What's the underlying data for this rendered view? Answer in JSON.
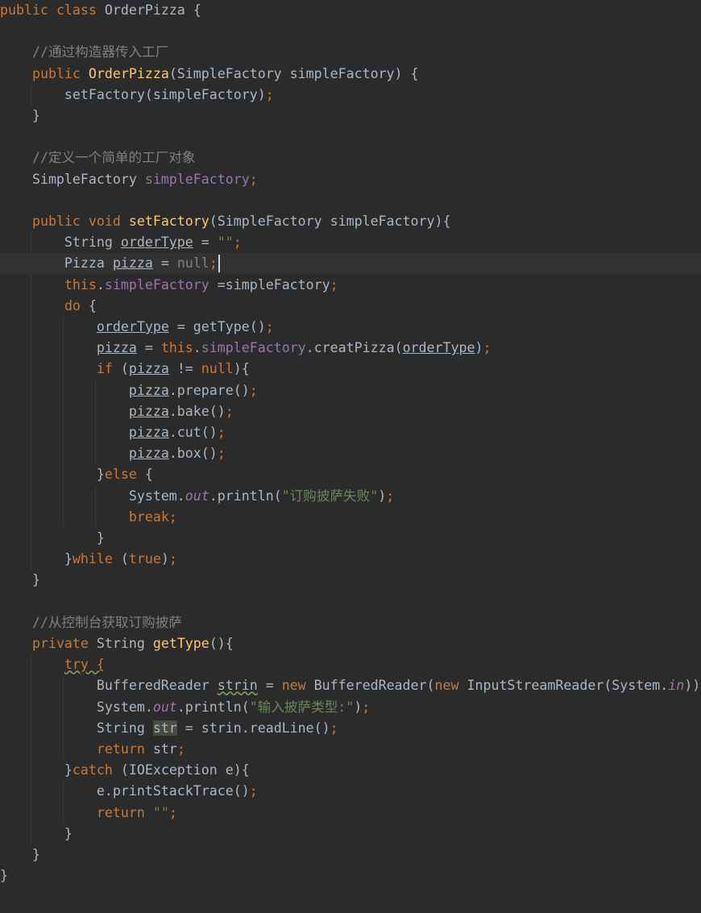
{
  "editor": {
    "theme_colors": {
      "background": "#2b2b2b",
      "current_line": "#323232",
      "default_text": "#a9b7c6",
      "keyword": "#cc7832",
      "function": "#ffc66d",
      "field": "#9876aa",
      "string": "#6a8759",
      "comment": "#808080"
    },
    "current_line_index": 12,
    "cursor_after": "null;",
    "lines": [
      [
        [
          "kw",
          "public "
        ],
        [
          "kw",
          "class "
        ],
        [
          "d",
          "OrderPizza {"
        ]
      ],
      [],
      [
        [
          "d",
          "    "
        ],
        [
          "cmt",
          "//通过构造器传入工厂"
        ]
      ],
      [
        [
          "d",
          "    "
        ],
        [
          "kw",
          "public "
        ],
        [
          "fn",
          "OrderPizza"
        ],
        [
          "d",
          "(SimpleFactory simpleFactory) {"
        ]
      ],
      [
        [
          "d",
          "        setFactory(simpleFactory)"
        ],
        [
          "kw",
          ";"
        ]
      ],
      [
        [
          "d",
          "    }"
        ]
      ],
      [],
      [
        [
          "d",
          "    "
        ],
        [
          "cmt",
          "//定义一个简单的工厂对象"
        ]
      ],
      [
        [
          "d",
          "    SimpleFactory "
        ],
        [
          "fld",
          "simpleFactory"
        ],
        [
          "kw",
          ";"
        ]
      ],
      [],
      [
        [
          "d",
          "    "
        ],
        [
          "kw",
          "public void "
        ],
        [
          "fn",
          "setFactory"
        ],
        [
          "d",
          "(SimpleFactory simpleFactory){"
        ]
      ],
      [
        [
          "d",
          "        String "
        ],
        [
          "ul",
          "orderType"
        ],
        [
          "d",
          " = "
        ],
        [
          "str",
          "\"\""
        ],
        [
          "kw",
          ";"
        ]
      ],
      [
        [
          "d",
          "        Pizza "
        ],
        [
          "ul",
          "pizza"
        ],
        [
          "d",
          " = "
        ],
        [
          "dim",
          "null"
        ],
        [
          "kw",
          ";"
        ]
      ],
      [
        [
          "d",
          "        "
        ],
        [
          "kw",
          "this"
        ],
        [
          "d",
          "."
        ],
        [
          "fld",
          "simpleFactory"
        ],
        [
          "d",
          " =simpleFactory"
        ],
        [
          "kw",
          ";"
        ]
      ],
      [
        [
          "d",
          "        "
        ],
        [
          "kw",
          "do "
        ],
        [
          "d",
          "{"
        ]
      ],
      [
        [
          "d",
          "            "
        ],
        [
          "ul",
          "orderType"
        ],
        [
          "d",
          " = getType()"
        ],
        [
          "kw",
          ";"
        ]
      ],
      [
        [
          "d",
          "            "
        ],
        [
          "ul",
          "pizza"
        ],
        [
          "d",
          " = "
        ],
        [
          "kw",
          "this"
        ],
        [
          "d",
          "."
        ],
        [
          "fld",
          "simpleFactory"
        ],
        [
          "d",
          ".creatPizza("
        ],
        [
          "ul",
          "orderType"
        ],
        [
          "d",
          ")"
        ],
        [
          "kw",
          ";"
        ]
      ],
      [
        [
          "d",
          "            "
        ],
        [
          "kw",
          "if "
        ],
        [
          "d",
          "("
        ],
        [
          "ul",
          "pizza"
        ],
        [
          "d",
          " != "
        ],
        [
          "kw",
          "null"
        ],
        [
          "d",
          "){"
        ]
      ],
      [
        [
          "d",
          "                "
        ],
        [
          "ul",
          "pizza"
        ],
        [
          "d",
          ".prepare()"
        ],
        [
          "kw",
          ";"
        ]
      ],
      [
        [
          "d",
          "                "
        ],
        [
          "ul",
          "pizza"
        ],
        [
          "d",
          ".bake()"
        ],
        [
          "kw",
          ";"
        ]
      ],
      [
        [
          "d",
          "                "
        ],
        [
          "ul",
          "pizza"
        ],
        [
          "d",
          ".cut()"
        ],
        [
          "kw",
          ";"
        ]
      ],
      [
        [
          "d",
          "                "
        ],
        [
          "ul",
          "pizza"
        ],
        [
          "d",
          ".box()"
        ],
        [
          "kw",
          ";"
        ]
      ],
      [
        [
          "d",
          "            }"
        ],
        [
          "kw",
          "else "
        ],
        [
          "d",
          "{"
        ]
      ],
      [
        [
          "d",
          "                System."
        ],
        [
          "static",
          "out"
        ],
        [
          "d",
          ".println("
        ],
        [
          "str",
          "\"订购披萨失败\""
        ],
        [
          "d",
          ")"
        ],
        [
          "kw",
          ";"
        ]
      ],
      [
        [
          "d",
          "                "
        ],
        [
          "kw",
          "break;"
        ]
      ],
      [
        [
          "d",
          "            }"
        ]
      ],
      [
        [
          "d",
          "        }"
        ],
        [
          "kw",
          "while "
        ],
        [
          "d",
          "("
        ],
        [
          "kw",
          "true"
        ],
        [
          "d",
          ")"
        ],
        [
          "kw",
          ";"
        ]
      ],
      [
        [
          "d",
          "    }"
        ]
      ],
      [],
      [
        [
          "d",
          "    "
        ],
        [
          "cmt",
          "//从控制台获取订购披萨"
        ]
      ],
      [
        [
          "d",
          "    "
        ],
        [
          "kw",
          "private "
        ],
        [
          "d",
          "String "
        ],
        [
          "fn",
          "getType"
        ],
        [
          "d",
          "(){"
        ]
      ],
      [
        [
          "d",
          "        "
        ],
        [
          "kwsq",
          "try {"
        ]
      ],
      [
        [
          "d",
          "            BufferedReader "
        ],
        [
          "squig",
          "strin"
        ],
        [
          "d",
          " = "
        ],
        [
          "kw",
          "new "
        ],
        [
          "d",
          "BufferedReader("
        ],
        [
          "kw",
          "new "
        ],
        [
          "d",
          "InputStreamReader(System."
        ],
        [
          "static",
          "in"
        ],
        [
          "d",
          "))"
        ],
        [
          "kw",
          ";"
        ]
      ],
      [
        [
          "d",
          "            System."
        ],
        [
          "static",
          "out"
        ],
        [
          "d",
          ".println("
        ],
        [
          "str",
          "\"输入披萨类型:\""
        ],
        [
          "d",
          ")"
        ],
        [
          "kw",
          ";"
        ]
      ],
      [
        [
          "d",
          "            String "
        ],
        [
          "hl",
          "str"
        ],
        [
          "d",
          " = strin.readLine()"
        ],
        [
          "kw",
          ";"
        ]
      ],
      [
        [
          "d",
          "            "
        ],
        [
          "kw",
          "return "
        ],
        [
          "d",
          "str"
        ],
        [
          "kw",
          ";"
        ]
      ],
      [
        [
          "d",
          "        }"
        ],
        [
          "kw",
          "catch "
        ],
        [
          "d",
          "(IOException e){"
        ]
      ],
      [
        [
          "d",
          "            e.printStackTrace()"
        ],
        [
          "kw",
          ";"
        ]
      ],
      [
        [
          "d",
          "            "
        ],
        [
          "kw",
          "return "
        ],
        [
          "str",
          "\"\""
        ],
        [
          "kw",
          ";"
        ]
      ],
      [
        [
          "d",
          "        }"
        ]
      ],
      [
        [
          "d",
          "    }"
        ]
      ],
      [
        [
          "d",
          "}"
        ]
      ]
    ]
  }
}
